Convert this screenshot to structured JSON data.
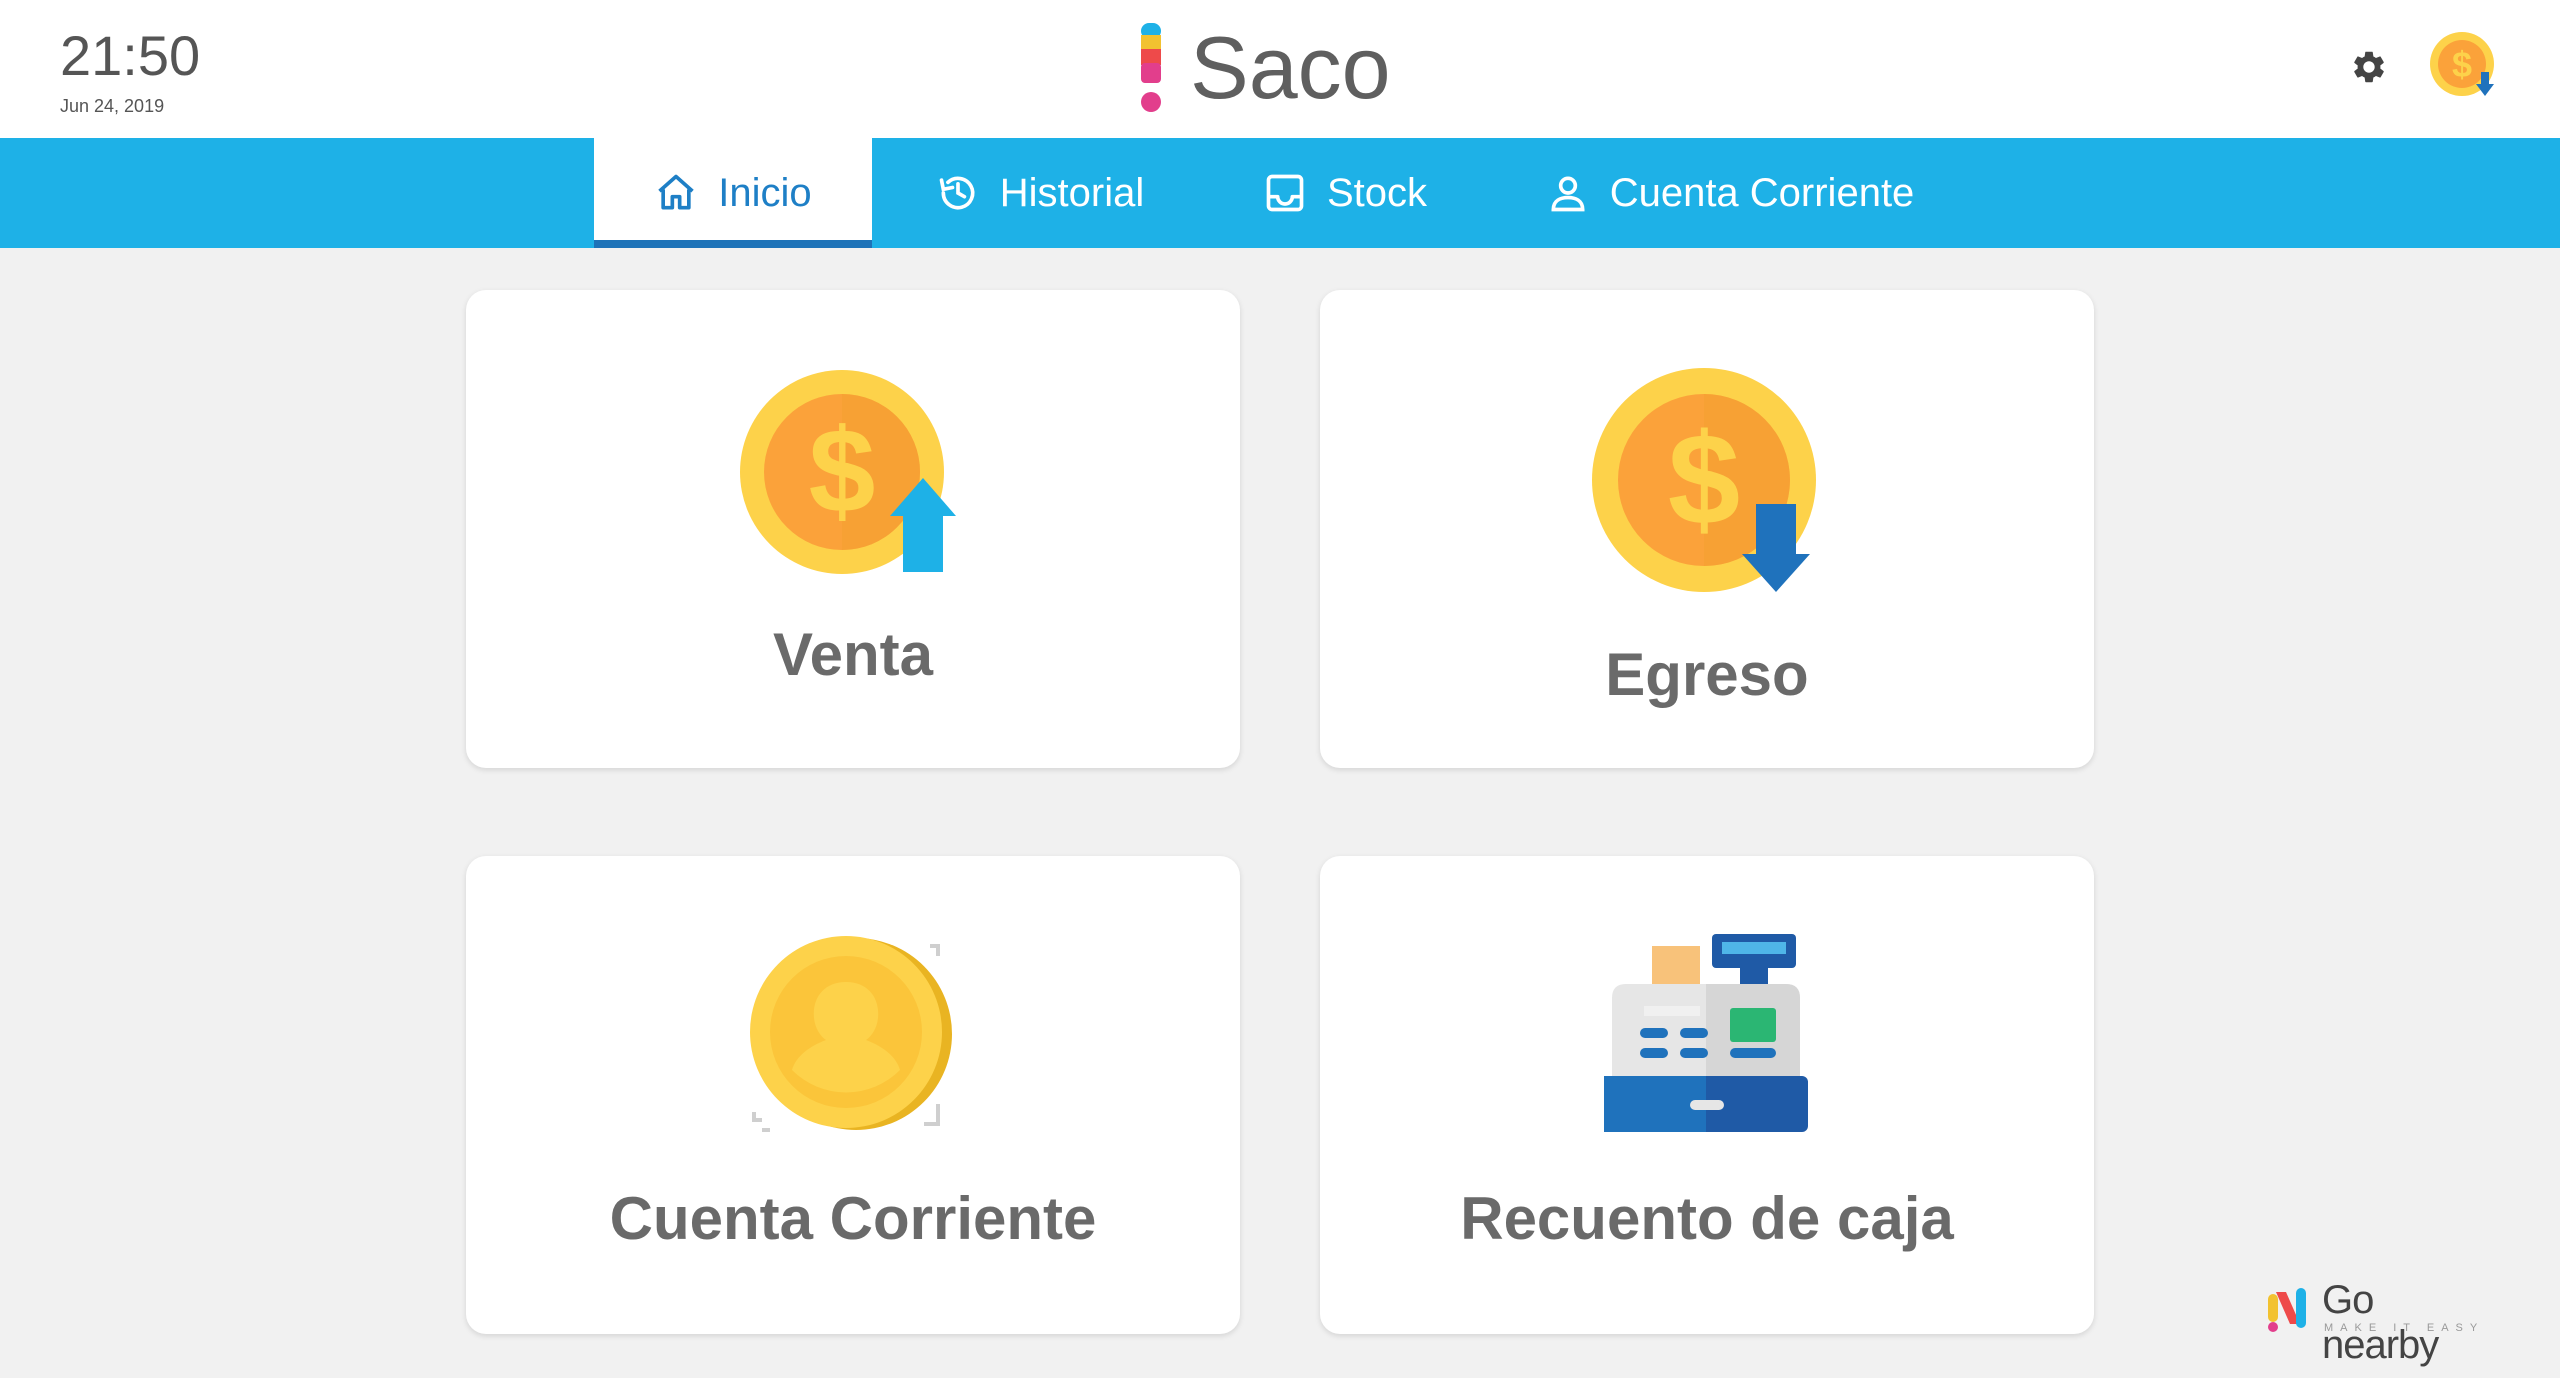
{
  "header": {
    "time": "21:50",
    "date": "Jun 24, 2019",
    "app_name": "Saco",
    "settings_icon": "gear-icon",
    "avatar_icon": "coin-download-icon"
  },
  "nav": {
    "tabs": [
      {
        "label": "Inicio",
        "icon": "home-icon",
        "active": true
      },
      {
        "label": "Historial",
        "icon": "history-icon",
        "active": false
      },
      {
        "label": "Stock",
        "icon": "inbox-icon",
        "active": false
      },
      {
        "label": "Cuenta Corriente",
        "icon": "person-icon",
        "active": false
      }
    ]
  },
  "cards": [
    {
      "label": "Venta",
      "icon": "coin-arrow-up-icon"
    },
    {
      "label": "Egreso",
      "icon": "coin-arrow-down-icon"
    },
    {
      "label": "Cuenta Corriente",
      "icon": "gold-coin-icon"
    },
    {
      "label": "Recuento de caja",
      "icon": "cash-register-icon"
    }
  ],
  "footer": {
    "brand": "Go nearby",
    "tagline": "MAKE IT EASY"
  },
  "colors": {
    "nav_bar": "#1eb1e7",
    "active_tab_text": "#1e7fc6",
    "background": "#f1f1f1",
    "coin_outer": "#fdd24a",
    "coin_inner": "#fba23a",
    "arrow_up": "#1eb1e7",
    "arrow_down": "#1f72bc"
  }
}
